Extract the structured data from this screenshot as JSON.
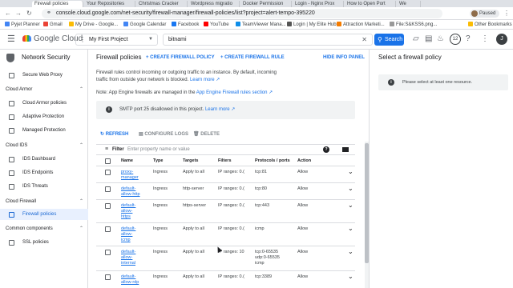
{
  "browser": {
    "tabs": [
      "Firewall policies",
      "Your Repositories",
      "Christmas Cracker",
      "Wordpress migratio",
      "Docker Permission",
      "Login - Nginx Prox",
      "How to Open Port",
      "We"
    ],
    "url": "console.cloud.google.com/net-security/firewall-manager/firewall-policies/list?project=alert-tempo-395220",
    "profile_status": "Paused",
    "bookmarks": [
      "Pyjet Planner",
      "Gmail",
      "My Drive - Google...",
      "Google Calendar",
      "Facebook",
      "YouTube",
      "TeamViewer Mana...",
      "Login | My Elite Hub",
      "Attraction Marketi...",
      "File:S&KSS6.png...",
      "Other Bookmarks"
    ]
  },
  "header": {
    "logo_text": "Google Cloud",
    "project": "My First Project",
    "search_value": "bitnami",
    "search_button": "Search",
    "notification_count": "12",
    "avatar_initial": "J"
  },
  "sidebar": {
    "title": "Network Security",
    "top_item": "Secure Web Proxy",
    "sections": [
      {
        "label": "Cloud Armor",
        "items": [
          "Cloud Armor policies",
          "Adaptive Protection",
          "Managed Protection"
        ]
      },
      {
        "label": "Cloud IDS",
        "items": [
          "IDS Dashboard",
          "IDS Endpoints",
          "IDS Threats"
        ]
      },
      {
        "label": "Cloud Firewall",
        "items": [
          "Firewall policies"
        ]
      },
      {
        "label": "Common components",
        "items": [
          "SSL policies"
        ]
      }
    ]
  },
  "main": {
    "title": "Firewall policies",
    "create_policy": "CREATE FIREWALL POLICY",
    "create_rule": "CREATE FIREWALL RULE",
    "hide_info": "HIDE INFO PANEL",
    "description": "Firewall rules control incoming or outgoing traffic to an instance. By default, incoming traffic from outside your network is blocked.",
    "learn_more": "Learn more",
    "note_prefix": "Note: App Engine firewalls are managed in the",
    "note_link": "App Engine Firewall rules section",
    "smtp_notice": "SMTP port 25 disallowed in this project.",
    "smtp_learn_more": "Learn more",
    "refresh": "REFRESH",
    "configure_logs": "CONFIGURE LOGS",
    "delete": "DELETE",
    "filter_label": "Filter",
    "filter_placeholder": "Enter property name or value",
    "columns": [
      "Name",
      "Type",
      "Targets",
      "Filters",
      "Protocols / ports",
      "Action"
    ],
    "rows": [
      {
        "name": [
          "proxy-",
          "manager"
        ],
        "type": "Ingress",
        "targets": "Apply to all",
        "filters": "IP ranges: 0.(",
        "protocols": [
          "tcp:81"
        ],
        "action": "Allow"
      },
      {
        "name": [
          "default-",
          "allow-http"
        ],
        "type": "Ingress",
        "targets": "http-server",
        "filters": "IP ranges: 0.(",
        "protocols": [
          "tcp:80"
        ],
        "action": "Allow"
      },
      {
        "name": [
          "default-",
          "allow-",
          "https"
        ],
        "type": "Ingress",
        "targets": "https-server",
        "filters": "IP ranges: 0.(",
        "protocols": [
          "tcp:443"
        ],
        "action": "Allow"
      },
      {
        "name": [
          "default-",
          "allow-",
          "icmp"
        ],
        "type": "Ingress",
        "targets": "Apply to all",
        "filters": "IP ranges: 0.(",
        "protocols": [
          "icmp"
        ],
        "action": "Allow"
      },
      {
        "name": [
          "default-",
          "allow-",
          "internal"
        ],
        "type": "Ingress",
        "targets": "Apply to all",
        "filters": "IP ranges: 10",
        "protocols": [
          "tcp:0-65535",
          "udp:0-65535",
          "icmp"
        ],
        "action": "Allow"
      },
      {
        "name": [
          "default-",
          "allow-rdp"
        ],
        "type": "Ingress",
        "targets": "Apply to all",
        "filters": "IP ranges: 0.(",
        "protocols": [
          "tcp:3389"
        ],
        "action": "Allow"
      }
    ]
  },
  "info_panel": {
    "title": "Select a firewall policy",
    "message": "Please select at least one resource."
  },
  "colors": {
    "accent": "#1a73e8",
    "active_bg": "#e8f0fe",
    "info_bg": "#f1f3f4"
  }
}
